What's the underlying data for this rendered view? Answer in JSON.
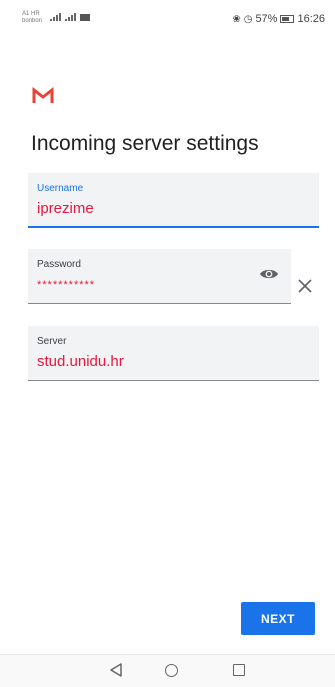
{
  "status_bar": {
    "carrier_line1": "A1 HR",
    "carrier_line2": "bonbon",
    "battery_percent": "57%",
    "time": "16:26"
  },
  "screen": {
    "title": "Incoming server settings"
  },
  "fields": {
    "username": {
      "label": "Username",
      "value": "iprezime"
    },
    "password": {
      "label": "Password",
      "value": "***********"
    },
    "server": {
      "label": "Server",
      "value": "stud.unidu.hr"
    }
  },
  "buttons": {
    "next_label": "NEXT"
  },
  "icons": {
    "logo": "gmail-logo-icon",
    "password_toggle": "eye-icon",
    "clear": "close-icon",
    "nav_back": "back-icon",
    "nav_home": "home-icon",
    "nav_recent": "recent-apps-icon"
  },
  "colors": {
    "accent": "#1a73e8",
    "input_text": "#e8173e",
    "field_background": "#f1f3f4",
    "logo_red": "#ea4335"
  }
}
